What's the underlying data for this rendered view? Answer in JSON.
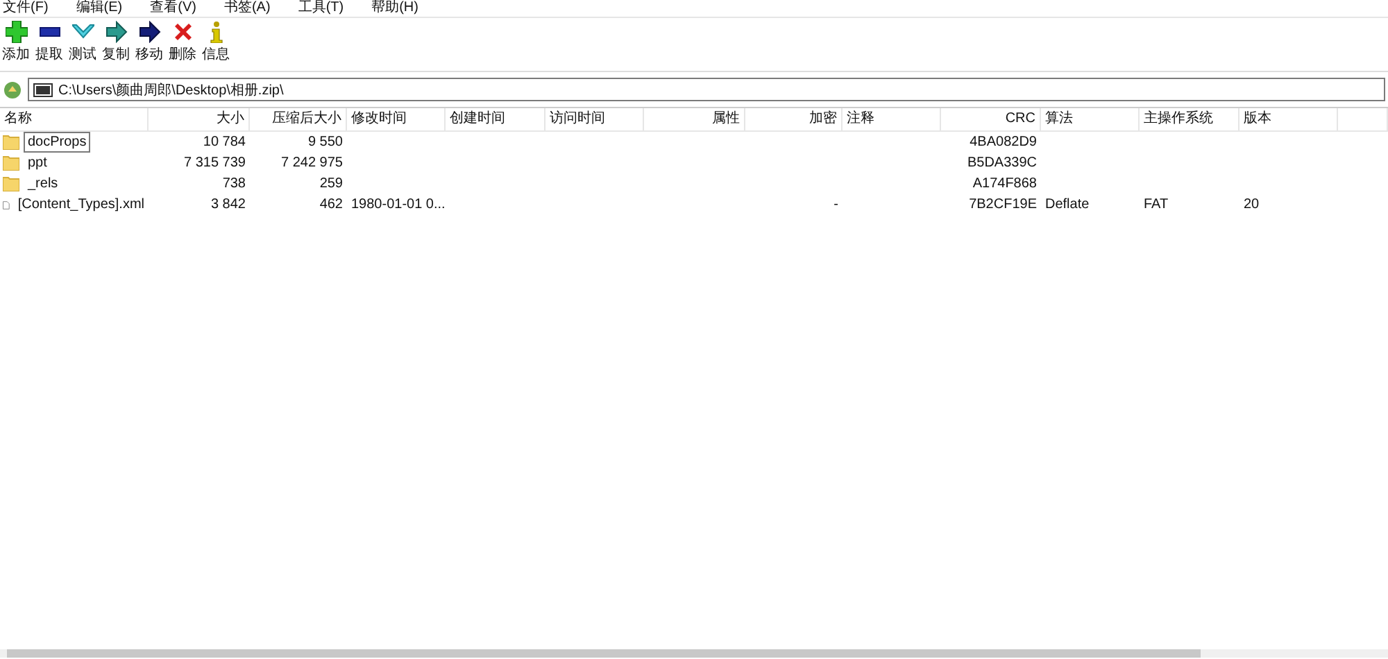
{
  "menu_bar": [
    "文件(F)",
    "编辑(E)",
    "查看(V)",
    "书签(A)",
    "工具(T)",
    "帮助(H)"
  ],
  "toolbar": [
    {
      "kind": "add",
      "label": "添加"
    },
    {
      "kind": "extract",
      "label": "提取"
    },
    {
      "kind": "test",
      "label": "测试"
    },
    {
      "kind": "copy",
      "label": "复制"
    },
    {
      "kind": "move",
      "label": "移动"
    },
    {
      "kind": "delete",
      "label": "删除"
    },
    {
      "kind": "info",
      "label": "信息"
    }
  ],
  "address_bar": {
    "path": "C:\\Users\\颜曲周郎\\Desktop\\相册.zip\\"
  },
  "table": {
    "columns": [
      {
        "label": "名称"
      },
      {
        "label": "大小"
      },
      {
        "label": "压缩后大小"
      },
      {
        "label": "修改时间"
      },
      {
        "label": "创建时间"
      },
      {
        "label": "访问时间"
      },
      {
        "label": "属性"
      },
      {
        "label": "加密"
      },
      {
        "label": "注释"
      },
      {
        "label": "CRC"
      },
      {
        "label": "算法"
      },
      {
        "label": "主操作系统"
      },
      {
        "label": "版本"
      }
    ],
    "rows": [
      {
        "kind": "folder",
        "selected": true,
        "cells": [
          "docProps",
          "10 784",
          "9 550",
          "",
          "",
          "",
          "",
          "",
          "",
          "4BA082D9",
          "",
          "",
          ""
        ]
      },
      {
        "kind": "folder",
        "selected": false,
        "cells": [
          "ppt",
          "7 315 739",
          "7 242 975",
          "",
          "",
          "",
          "",
          "",
          "",
          "B5DA339C",
          "",
          "",
          ""
        ]
      },
      {
        "kind": "folder",
        "selected": false,
        "cells": [
          "_rels",
          "738",
          "259",
          "",
          "",
          "",
          "",
          "",
          "",
          "A174F868",
          "",
          "",
          ""
        ]
      },
      {
        "kind": "file",
        "selected": false,
        "cells": [
          "[Content_Types].xml",
          "3 842",
          "462",
          "1980-01-01 0...",
          "",
          "",
          "",
          "-",
          "",
          "7B2CF19E",
          "Deflate",
          "FAT",
          "20"
        ]
      }
    ]
  }
}
